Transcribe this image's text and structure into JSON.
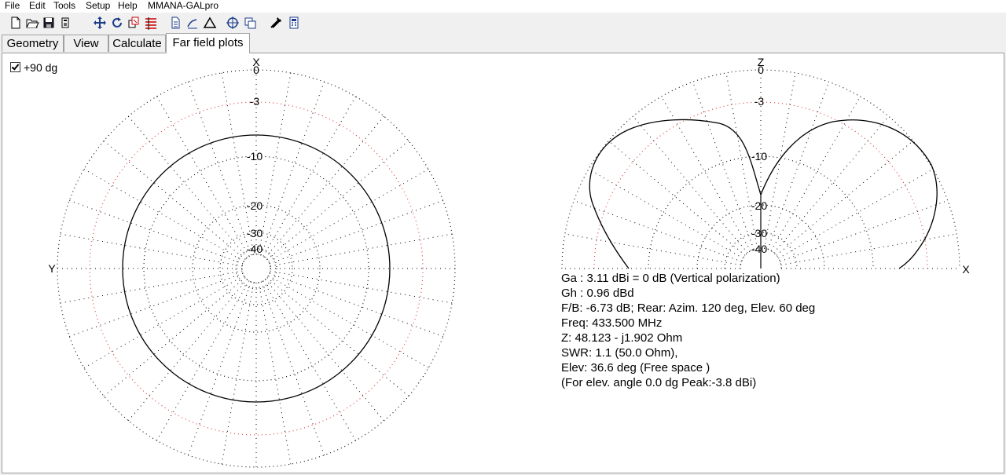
{
  "menu": [
    "File",
    "Edit",
    "Tools",
    "Setup",
    "Help",
    "MMANA-GALpro"
  ],
  "toolbar_icons": [
    "new-file-icon",
    "open-folder-icon",
    "save-icon",
    "calculator-file-icon",
    "move-icon",
    "rotate-icon",
    "copy-icon",
    "wires-icon",
    "page-icon",
    "edit-icon",
    "triangle-icon",
    "target-icon",
    "duplicate-icon",
    "tools-icon",
    "calculator-icon"
  ],
  "tabs": [
    {
      "label": "Geometry",
      "active": false
    },
    {
      "label": "View",
      "active": false
    },
    {
      "label": "Calculate",
      "active": false
    },
    {
      "label": "Far field plots",
      "active": true
    }
  ],
  "checkbox": {
    "label": "+90 dg",
    "checked": true
  },
  "left_plot": {
    "top_label": "X",
    "left_label": "Y",
    "db_labels": [
      "0",
      "-3",
      "-10",
      "-20",
      "-30",
      "-40"
    ]
  },
  "right_plot": {
    "top_label": "Z",
    "right_label": "X",
    "db_labels": [
      "0",
      "-3",
      "-10",
      "-20",
      "-30",
      "-40"
    ]
  },
  "info_lines": [
    "Ga : 3.11 dBi = 0 dB  (Vertical polarization)",
    "Gh : 0.96 dBd",
    "F/B: -6.73 dB; Rear: Azim. 120 deg,  Elev. 60 deg",
    "Freq: 433.500 MHz",
    "Z: 48.123 - j1.902 Ohm",
    "SWR: 1.1 (50.0 Ohm),",
    "Elev: 36.6 deg (Free space )",
    "(For elev. angle 0.0 dg Peak:-3.8 dBi)"
  ],
  "colors": {
    "grid": "#000000",
    "ring_minus3": "#e03030",
    "pattern": "#000000"
  }
}
